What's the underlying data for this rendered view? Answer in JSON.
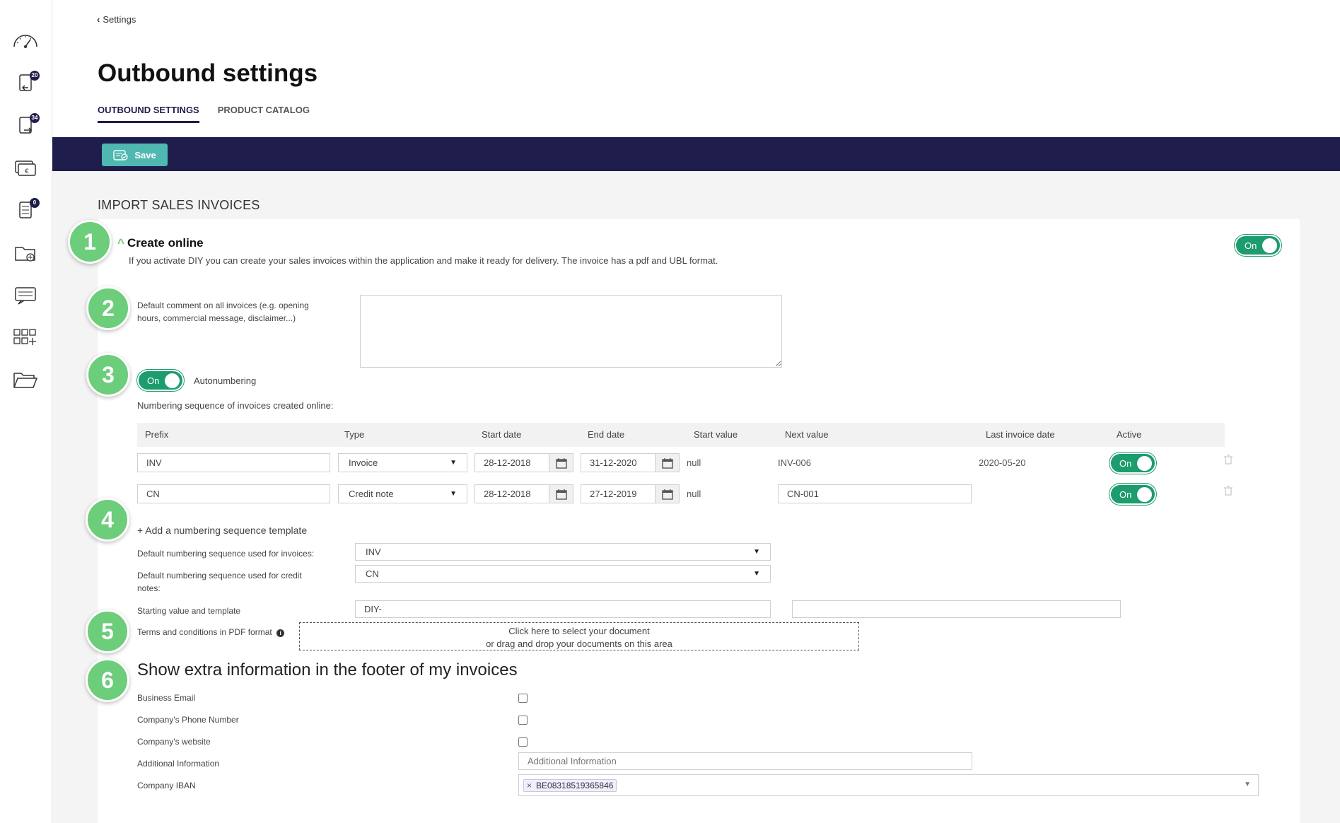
{
  "sidebar": {
    "items": [
      {
        "name": "dashboard-icon",
        "badge": ""
      },
      {
        "name": "inbound-documents-icon",
        "badge": "20"
      },
      {
        "name": "outbound-documents-icon",
        "badge": "34"
      },
      {
        "name": "payments-icon",
        "badge": ""
      },
      {
        "name": "tasks-icon",
        "badge": "0"
      },
      {
        "name": "add-folder-icon",
        "badge": ""
      },
      {
        "name": "messages-icon",
        "badge": ""
      },
      {
        "name": "apps-icon",
        "badge": ""
      },
      {
        "name": "open-folder-icon",
        "badge": ""
      }
    ]
  },
  "header": {
    "breadcrumb": "Settings",
    "title": "Outbound settings",
    "tabs": [
      {
        "label": "OUTBOUND SETTINGS",
        "active": true
      },
      {
        "label": "PRODUCT CATALOG",
        "active": false
      }
    ]
  },
  "toolbar": {
    "save_label": "Save"
  },
  "section": {
    "title": "IMPORT SALES INVOICES",
    "create_online": {
      "heading": "Create online",
      "description": "If you activate DIY you can create your sales invoices within the application and make it ready for delivery. The invoice has a pdf and UBL format.",
      "toggle": "On"
    },
    "default_comment": {
      "label_line1": "Default comment on all invoices (e.g. opening",
      "label_line2": "hours, commercial message, disclaimer...)",
      "value": ""
    },
    "autonumbering": {
      "toggle": "On",
      "label": "Autonumbering",
      "sequence_label": "Numbering sequence of invoices created online:"
    },
    "table": {
      "headers": [
        "Prefix",
        "Type",
        "Start date",
        "End date",
        "Start value",
        "Next value",
        "Last invoice date",
        "Active"
      ],
      "rows": [
        {
          "prefix": "INV",
          "type": "Invoice",
          "start_date": "28-12-2018",
          "end_date": "31-12-2020",
          "start_value": "null",
          "next_value": "INV-006",
          "last_invoice_date": "2020-05-20",
          "active": "On"
        },
        {
          "prefix": "CN",
          "type": "Credit note",
          "start_date": "28-12-2018",
          "end_date": "27-12-2019",
          "start_value": "null",
          "next_value": "CN-001",
          "last_invoice_date": "",
          "active": "On"
        }
      ]
    },
    "add_template": "+ Add a numbering sequence template",
    "default_invoices_label": "Default numbering sequence used for invoices:",
    "default_invoices_value": "INV",
    "default_credit_label_line1": "Default numbering sequence used for credit",
    "default_credit_label_line2": "notes:",
    "default_credit_value": "CN",
    "starting_value_label": "Starting value and template",
    "starting_value": "DIY-",
    "starting_template": "",
    "terms_label": "Terms and conditions in PDF format",
    "upload_line1": "Click here to select your document",
    "upload_line2": "or drag and drop your documents on this area",
    "footer_heading": "Show extra information in the footer of my invoices",
    "footer_fields": {
      "business_email": "Business Email",
      "phone": "Company's Phone Number",
      "website": "Company's website",
      "additional": "Additional Information",
      "additional_placeholder": "Additional Information",
      "iban": "Company IBAN",
      "iban_value": "BE08318519365846"
    },
    "steps": [
      "1",
      "2",
      "3",
      "4",
      "5",
      "6"
    ]
  },
  "colors": {
    "navy": "#1f1d4b",
    "toggle_green": "#1d9c6e",
    "step_green": "#6ccd7a",
    "save_teal": "#4fb8b0"
  }
}
